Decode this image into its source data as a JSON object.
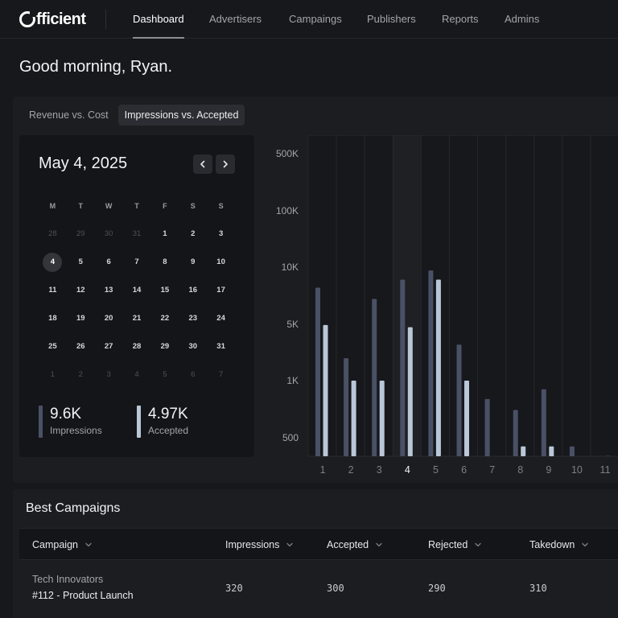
{
  "brand": {
    "name": "fficient"
  },
  "nav": {
    "items": [
      "Dashboard",
      "Advertisers",
      "Campaings",
      "Publishers",
      "Reports",
      "Admins"
    ],
    "active": "Dashboard"
  },
  "greeting": "Good morning, Ryan.",
  "toggle": {
    "options": [
      "Revenue vs. Cost",
      "Impressions vs. Accepted"
    ],
    "selected": "Impressions vs. Accepted"
  },
  "calendar": {
    "title": "May 4, 2025",
    "weekdays": [
      "M",
      "T",
      "W",
      "T",
      "F",
      "S",
      "S"
    ],
    "weeks": [
      [
        "28",
        "29",
        "30",
        "31",
        "1",
        "2",
        "3"
      ],
      [
        "4",
        "5",
        "6",
        "7",
        "8",
        "9",
        "10"
      ],
      [
        "11",
        "12",
        "13",
        "14",
        "15",
        "16",
        "17"
      ],
      [
        "18",
        "19",
        "20",
        "21",
        "22",
        "23",
        "24"
      ],
      [
        "25",
        "26",
        "27",
        "28",
        "29",
        "30",
        "31"
      ],
      [
        "1",
        "2",
        "3",
        "4",
        "5",
        "6",
        "7"
      ]
    ],
    "selected_day": "4",
    "prev_icon": "chevron-left-icon",
    "next_icon": "chevron-right-icon"
  },
  "stats": {
    "impressions": {
      "value": "9.6K",
      "label": "Impressions"
    },
    "accepted": {
      "value": "4.97K",
      "label": "Accepted"
    }
  },
  "colors": {
    "impressions": "#4a5166",
    "accepted": "#b9c7d8",
    "highlight": "#1f2023",
    "background": "#17181b"
  },
  "chart_data": {
    "type": "bar",
    "scale": "log",
    "title": "",
    "xlabel": "",
    "ylabel": "",
    "y_ticks": [
      "500K",
      "100K",
      "10K",
      "5K",
      "1K",
      "500"
    ],
    "y_tick_values": [
      500000,
      100000,
      10000,
      5000,
      1000,
      500
    ],
    "categories": [
      "1",
      "2",
      "3",
      "4",
      "5",
      "6",
      "7",
      "8",
      "9",
      "10",
      "11"
    ],
    "highlighted_category": "4",
    "series": [
      {
        "values": [
          7800,
          1900,
          6800,
          8600,
          9600,
          2800,
          800,
          700,
          900,
          450,
          400
        ]
      },
      {
        "values": [
          4900,
          1000,
          1000,
          4600,
          8600,
          1000,
          300,
          450,
          450,
          350,
          400
        ]
      }
    ]
  },
  "campaigns": {
    "title": "Best Campaigns",
    "columns": [
      "Campaign",
      "Impressions",
      "Accepted",
      "Rejected",
      "Takedown"
    ],
    "rows": [
      {
        "client": "Tech Innovators",
        "campaign": "#112 - Product Launch",
        "impressions": "320",
        "accepted": "300",
        "rejected": "290",
        "takedown": "310"
      }
    ]
  }
}
